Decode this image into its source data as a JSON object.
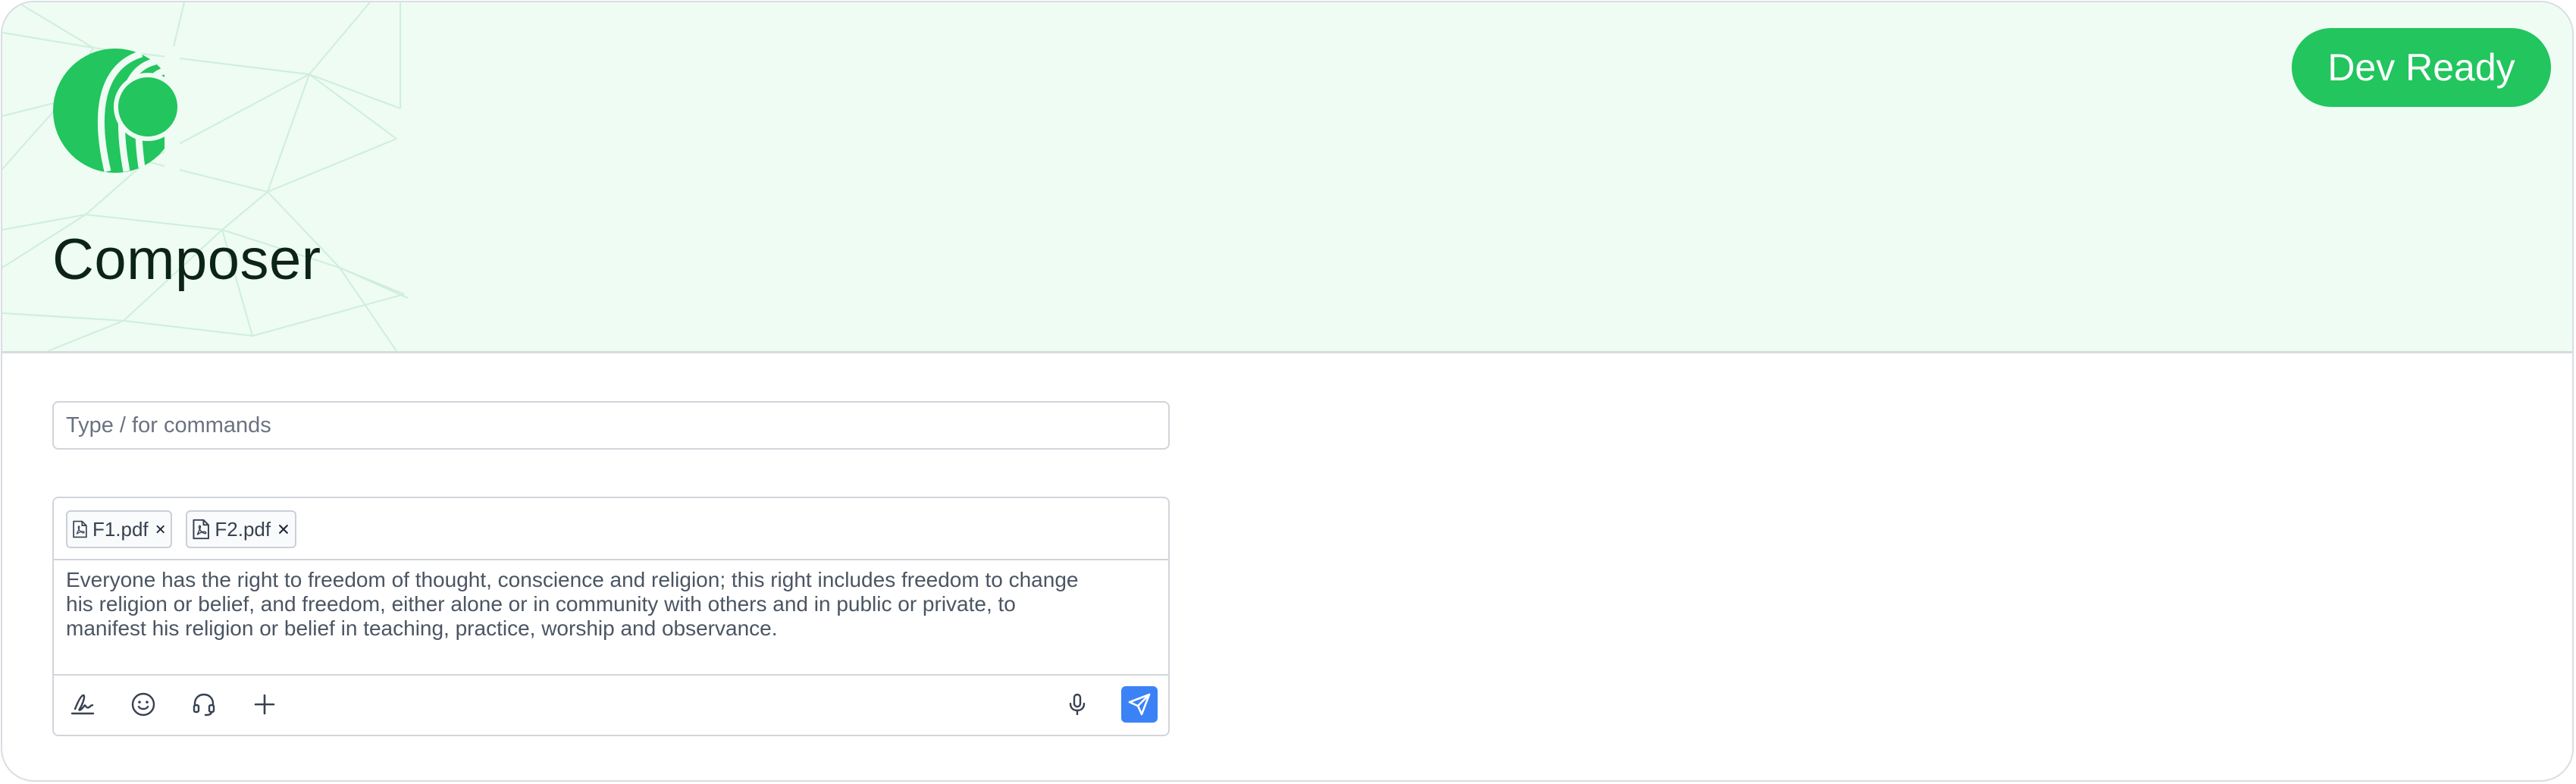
{
  "app": {
    "title": "Composer",
    "status_badge": "Dev Ready"
  },
  "colors": {
    "accent": "#22c55e",
    "header_bg": "#eefcf3",
    "send_button": "#3b82f6"
  },
  "command_bar": {
    "placeholder": "Type / for commands",
    "value": ""
  },
  "composer": {
    "attachments": [
      {
        "name": "F1.pdf",
        "icon": "pdf-file-icon"
      },
      {
        "name": "F2.pdf",
        "icon": "pdf-file-icon"
      }
    ],
    "message_lines": [
      "Everyone has the right to freedom of thought, conscience and religion; this right includes freedom to change",
      "his religion or belief, and freedom, either alone or in community with others and in public or private, to",
      "manifest his religion or belief in teaching, practice, worship and observance."
    ],
    "toolbar_icons": [
      "signature-icon",
      "emoji-icon",
      "headset-icon",
      "plus-icon",
      "microphone-icon",
      "send-icon"
    ]
  }
}
